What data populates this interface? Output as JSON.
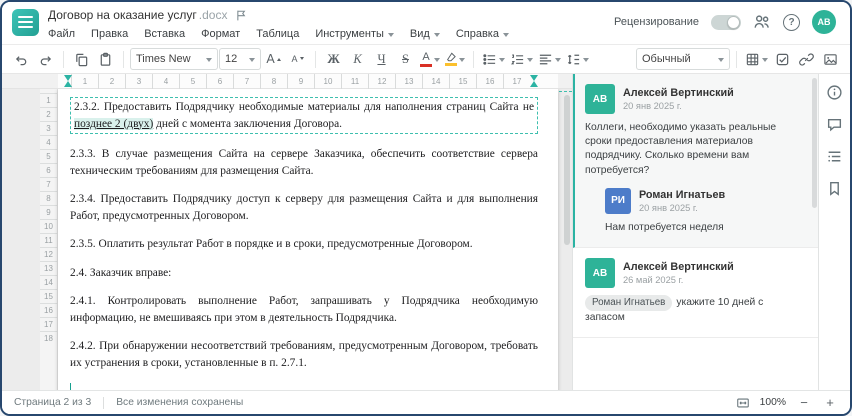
{
  "window": {
    "title": "Договор на оказание услуг",
    "ext": ".docx"
  },
  "menu": {
    "items": [
      "Файл",
      "Правка",
      "Вставка",
      "Формат",
      "Таблица",
      "Инструменты",
      "Вид",
      "Справка"
    ]
  },
  "header": {
    "review": "Рецензирование",
    "avatar_initials": "АВ"
  },
  "toolbar": {
    "font": "Times New",
    "size": "12",
    "bold": "Ж",
    "italic": "К",
    "underline": "Ч",
    "strike": "S",
    "color_letter": "А",
    "inc_letter": "А",
    "dec_letter": "А",
    "style": "Обычный"
  },
  "ruler": {
    "h": [
      "1",
      "2",
      "3",
      "4",
      "5",
      "6",
      "7",
      "8",
      "9",
      "10",
      "11",
      "12",
      "13",
      "14",
      "15",
      "16",
      "17"
    ],
    "v": [
      "1",
      "2",
      "3",
      "4",
      "5",
      "6",
      "7",
      "8",
      "9",
      "10",
      "11",
      "12",
      "13",
      "14",
      "15",
      "16",
      "17",
      "18"
    ]
  },
  "doc": {
    "p1_pre": "2.3.2. Предоставить Подрядчику необходимые материалы для наполнения страниц Сайта не ",
    "p1_anchor": "позднее 2 (двух)",
    "p1_post": " дней с момента заключения Договора.",
    "p2": "2.3.3. В случае размещения Сайта на сервере Заказчика, обеспечить соответствие сервера техническим требованиям для размещения Сайта.",
    "p3": "2.3.4. Предоставить Подрядчику доступ к серверу для размещения Сайта и для выполнения Работ, предусмотренных Договором.",
    "p4": "2.3.5. Оплатить результат Работ в порядке и в сроки, предусмотренные Договором.",
    "p5": "2.4. Заказчик вправе:",
    "p6": "2.4.1. Контролировать выполнение Работ, запрашивать у Подрядчика необходимую информацию, не вмешиваясь при этом в деятельность Подрядчика.",
    "p7": "2.4.2. При обнаружении несоответствий требованиям, предусмотренным Договором, требовать их устранения в сроки, установленные в п. 2.7.1."
  },
  "comments": {
    "c1": {
      "initials": "АВ",
      "author": "Алексей Вертинский",
      "date": "20 янв 2025 г.",
      "text": "Коллеги, необходимо указать реальные сроки предоставления материалов подрядчику. Сколько времени вам потребуется?"
    },
    "c1_reply": {
      "initials": "РИ",
      "author": "Роман Игнатьев",
      "date": "20 янв 2025 г.",
      "text": "Нам потребуется неделя"
    },
    "c2": {
      "initials": "АВ",
      "author": "Алексей Вертинский",
      "date": "26 май 2025 г.",
      "mention": "Роман Игнатьев",
      "text": "укажите 10 дней с запасом"
    }
  },
  "status": {
    "page": "Страница 2 из 3",
    "saved": "Все изменения сохранены",
    "zoom": "100%"
  },
  "colors": {
    "accent": "#2bb3a3",
    "avatar_green": "#2eb398",
    "avatar_blue": "#4d7cc9",
    "window_border": "#27476e"
  }
}
